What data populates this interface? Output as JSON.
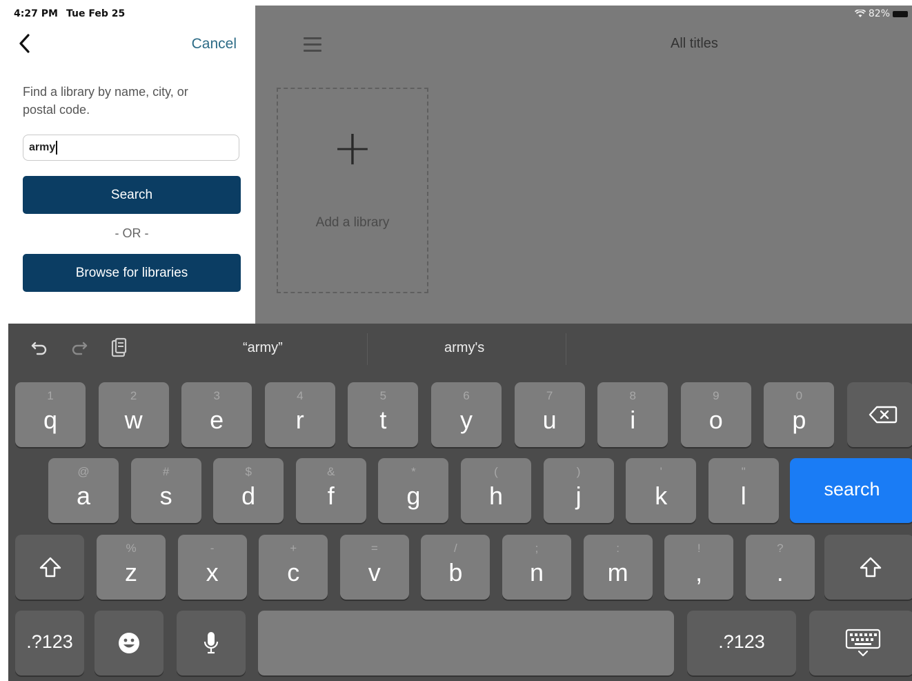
{
  "status_bar": {
    "time": "4:27 PM",
    "date": "Tue Feb 25",
    "battery": "82%",
    "wifi_icon": "wifi-icon"
  },
  "left_panel": {
    "back_icon": "chevron-left-icon",
    "cancel_label": "Cancel",
    "prompt": "Find a library by name, city, or postal code.",
    "search_value": "army",
    "search_button": "Search",
    "or_label": "- OR -",
    "browse_button": "Browse for libraries"
  },
  "main": {
    "menu_icon": "hamburger-menu-icon",
    "title": "All titles",
    "add_card": {
      "plus": "+",
      "label": "Add a library"
    }
  },
  "keyboard": {
    "toolbar_icons": [
      "undo-icon",
      "redo-icon",
      "paste-icon"
    ],
    "suggestions": [
      "“army”",
      "army's"
    ],
    "row1": [
      {
        "alt": "1",
        "key": "q"
      },
      {
        "alt": "2",
        "key": "w"
      },
      {
        "alt": "3",
        "key": "e"
      },
      {
        "alt": "4",
        "key": "r"
      },
      {
        "alt": "5",
        "key": "t"
      },
      {
        "alt": "6",
        "key": "y"
      },
      {
        "alt": "7",
        "key": "u"
      },
      {
        "alt": "8",
        "key": "i"
      },
      {
        "alt": "9",
        "key": "o"
      },
      {
        "alt": "0",
        "key": "p"
      }
    ],
    "row2": [
      {
        "alt": "@",
        "key": "a"
      },
      {
        "alt": "#",
        "key": "s"
      },
      {
        "alt": "$",
        "key": "d"
      },
      {
        "alt": "&",
        "key": "f"
      },
      {
        "alt": "*",
        "key": "g"
      },
      {
        "alt": "(",
        "key": "h"
      },
      {
        "alt": ")",
        "key": "j"
      },
      {
        "alt": "'",
        "key": "k"
      },
      {
        "alt": "\"",
        "key": "l"
      }
    ],
    "row3": [
      {
        "alt": "%",
        "key": "z"
      },
      {
        "alt": "-",
        "key": "x"
      },
      {
        "alt": "+",
        "key": "c"
      },
      {
        "alt": "=",
        "key": "v"
      },
      {
        "alt": "/",
        "key": "b"
      },
      {
        "alt": ";",
        "key": "n"
      },
      {
        "alt": ":",
        "key": "m"
      },
      {
        "alt": "!",
        "key": ","
      },
      {
        "alt": "?",
        "key": "."
      }
    ],
    "search_key": "search",
    "numbers_key": ".?123",
    "emoji_icon": "emoji-icon",
    "mic_icon": "microphone-icon",
    "dismiss_icon": "keyboard-dismiss-icon",
    "delete_icon": "backspace-icon",
    "shift_icon": "shift-icon"
  }
}
